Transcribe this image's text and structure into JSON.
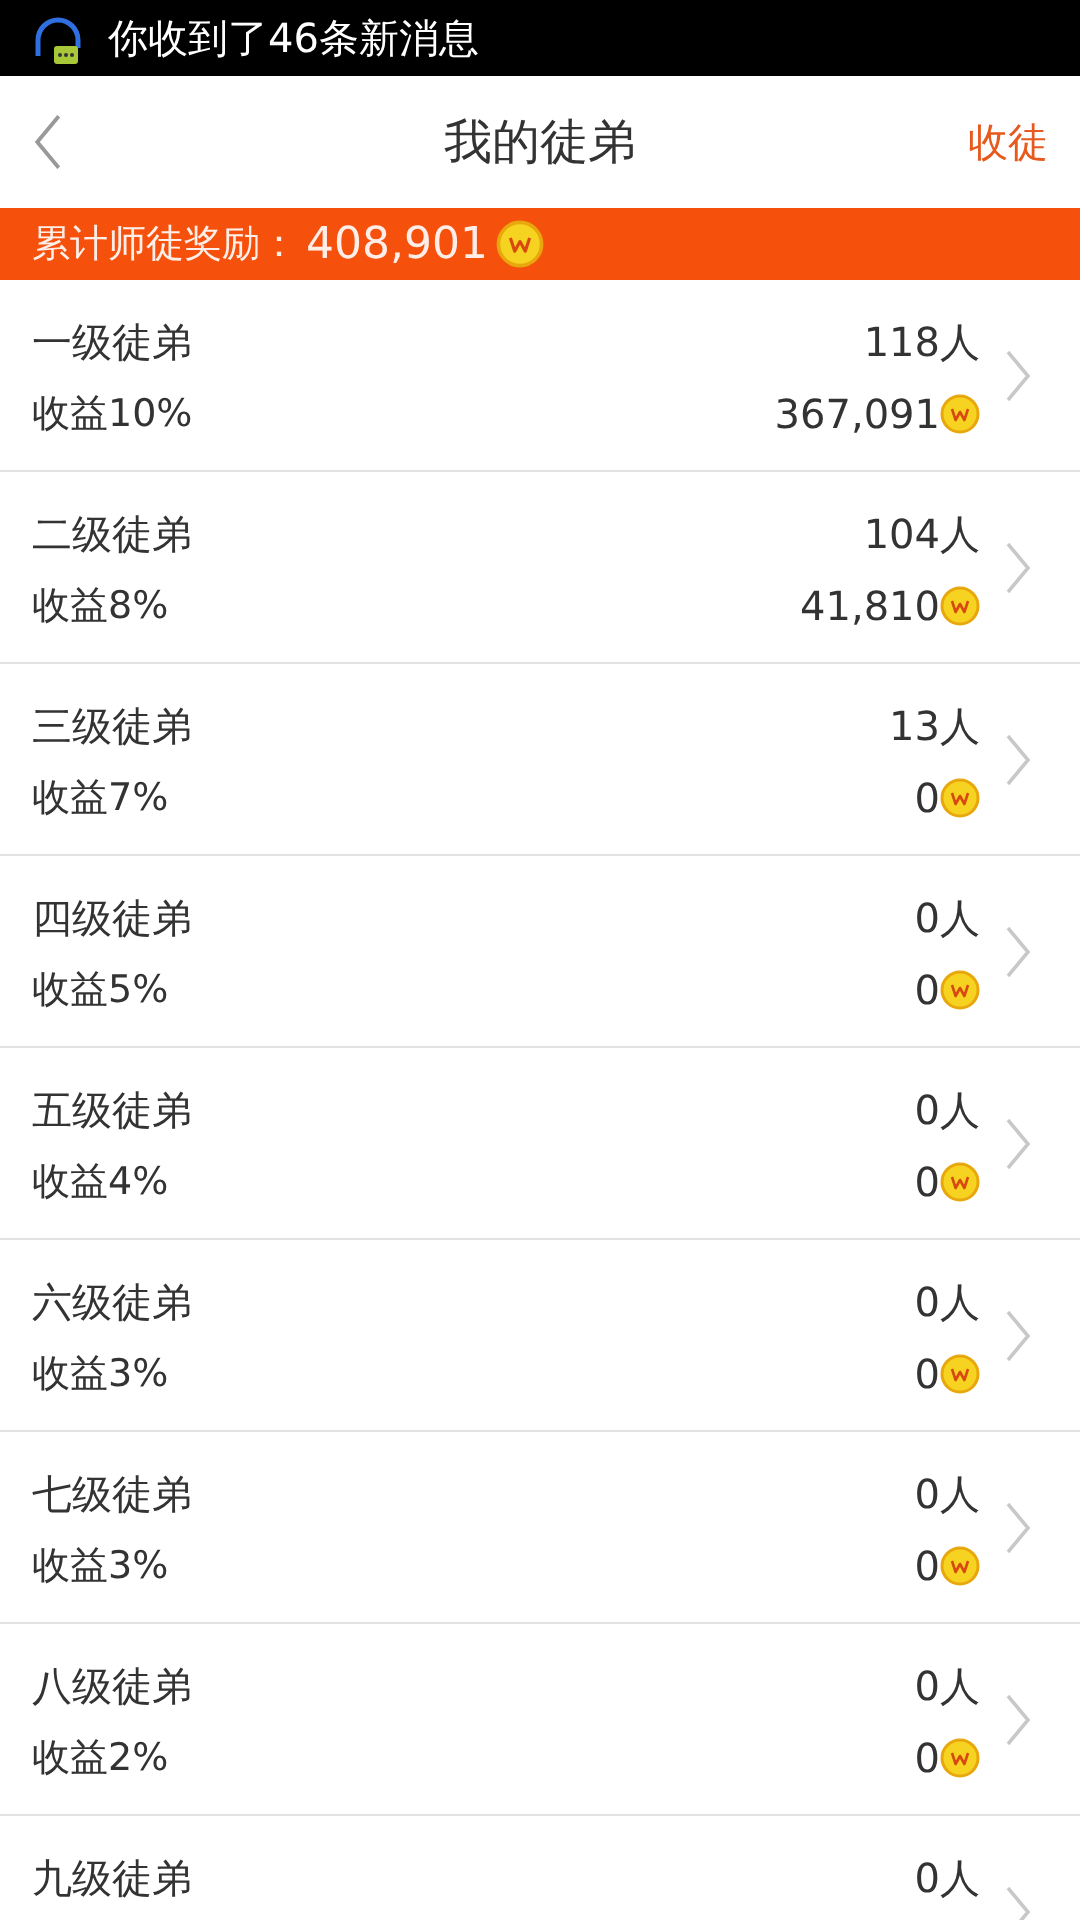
{
  "status_bar": {
    "notification": "你收到了46条新消息"
  },
  "header": {
    "title": "我的徒弟",
    "action": "收徒"
  },
  "banner": {
    "label": "累计师徒奖励：",
    "total": "408,901"
  },
  "levels": [
    {
      "name": "一级徒弟",
      "rate": "收益10%",
      "count": "118人",
      "earnings": "367,091"
    },
    {
      "name": "二级徒弟",
      "rate": "收益8%",
      "count": "104人",
      "earnings": "41,810"
    },
    {
      "name": "三级徒弟",
      "rate": "收益7%",
      "count": "13人",
      "earnings": "0"
    },
    {
      "name": "四级徒弟",
      "rate": "收益5%",
      "count": "0人",
      "earnings": "0"
    },
    {
      "name": "五级徒弟",
      "rate": "收益4%",
      "count": "0人",
      "earnings": "0"
    },
    {
      "name": "六级徒弟",
      "rate": "收益3%",
      "count": "0人",
      "earnings": "0"
    },
    {
      "name": "七级徒弟",
      "rate": "收益3%",
      "count": "0人",
      "earnings": "0"
    },
    {
      "name": "八级徒弟",
      "rate": "收益2%",
      "count": "0人",
      "earnings": "0"
    },
    {
      "name": "九级徒弟",
      "count": "0人"
    }
  ]
}
